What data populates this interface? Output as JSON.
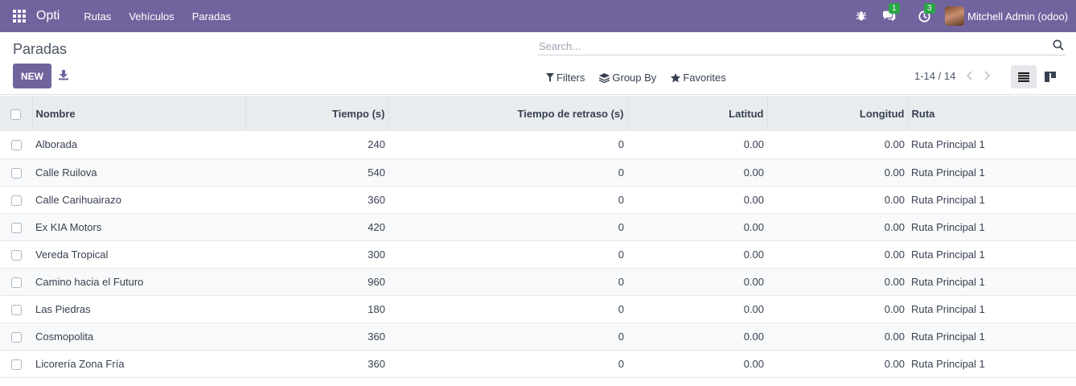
{
  "navbar": {
    "brand": "Opti",
    "menu": [
      "Rutas",
      "Vehículos",
      "Paradas"
    ],
    "messages_badge": "1",
    "activity_badge": "3",
    "user": "Mitchell Admin (odoo)",
    "icons": [
      "apps-grid-icon",
      "bug-icon",
      "chat-icon",
      "clock-icon"
    ],
    "background_color": "#71639e"
  },
  "control_panel": {
    "title": "Paradas",
    "new_label": "NEW",
    "search_placeholder": "Search...",
    "filters_label": "Filters",
    "group_by_label": "Group By",
    "favorites_label": "Favorites",
    "pager": "1-14 / 14",
    "active_view": "list"
  },
  "table": {
    "columns": [
      "Nombre",
      "Tiempo (s)",
      "Tiempo de retraso (s)",
      "Latitud",
      "Longitud",
      "Ruta"
    ],
    "rows": [
      {
        "nombre": "Alborada",
        "tiempo": "240",
        "retraso": "0",
        "latitud": "0.00",
        "longitud": "0.00",
        "ruta": "Ruta Principal 1"
      },
      {
        "nombre": "Calle Ruilova",
        "tiempo": "540",
        "retraso": "0",
        "latitud": "0.00",
        "longitud": "0.00",
        "ruta": "Ruta Principal 1"
      },
      {
        "nombre": "Calle Carihuairazo",
        "tiempo": "360",
        "retraso": "0",
        "latitud": "0.00",
        "longitud": "0.00",
        "ruta": "Ruta Principal 1"
      },
      {
        "nombre": "Ex KIA Motors",
        "tiempo": "420",
        "retraso": "0",
        "latitud": "0.00",
        "longitud": "0.00",
        "ruta": "Ruta Principal 1"
      },
      {
        "nombre": "Vereda Tropical",
        "tiempo": "300",
        "retraso": "0",
        "latitud": "0.00",
        "longitud": "0.00",
        "ruta": "Ruta Principal 1"
      },
      {
        "nombre": "Camino hacia el Futuro",
        "tiempo": "960",
        "retraso": "0",
        "latitud": "0.00",
        "longitud": "0.00",
        "ruta": "Ruta Principal 1"
      },
      {
        "nombre": "Las Piedras",
        "tiempo": "180",
        "retraso": "0",
        "latitud": "0.00",
        "longitud": "0.00",
        "ruta": "Ruta Principal 1"
      },
      {
        "nombre": "Cosmopolita",
        "tiempo": "360",
        "retraso": "0",
        "latitud": "0.00",
        "longitud": "0.00",
        "ruta": "Ruta Principal 1"
      },
      {
        "nombre": "Licorería Zona Fría",
        "tiempo": "360",
        "retraso": "0",
        "latitud": "0.00",
        "longitud": "0.00",
        "ruta": "Ruta Principal 1"
      }
    ]
  }
}
